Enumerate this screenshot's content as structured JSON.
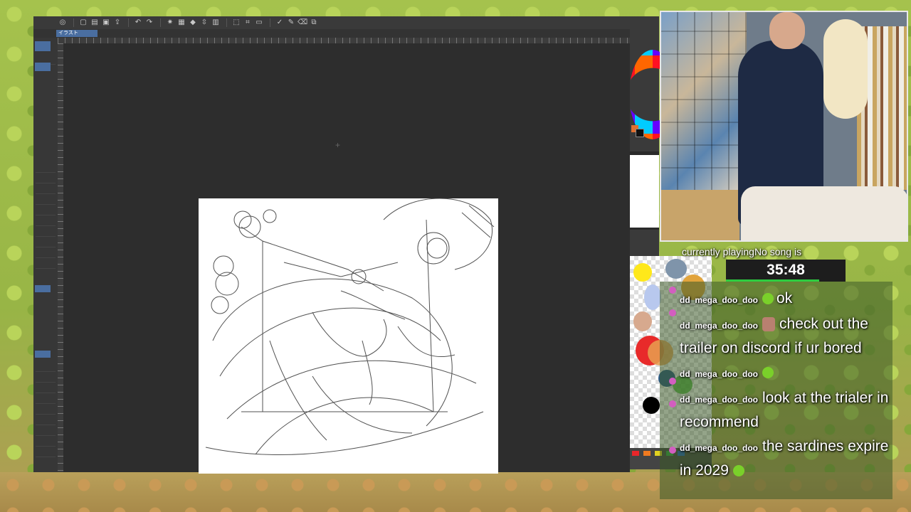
{
  "app": {
    "document_tab": "イラスト",
    "toolbar_icons": [
      "app-menu-icon",
      "new-icon",
      "open-icon",
      "save-icon",
      "undo-icon",
      "redo-icon",
      "settings-icon",
      "fill-icon",
      "transform-icon",
      "pen-icon",
      "brush-icon",
      "eraser-icon",
      "select-icon"
    ]
  },
  "overlay": {
    "now_playing": "currently playingNo song is",
    "timer": "35:48",
    "timer_progress": 0.78
  },
  "chat": [
    {
      "user": "dd_mega_doo_doo",
      "emote": "green-blob",
      "text": "ok"
    },
    {
      "user": "dd_mega_doo_doo",
      "emote": "face",
      "text": "check out the trailer on discord if ur bored"
    },
    {
      "user": "dd_mega_doo_doo",
      "emote": "green-blob",
      "text": ""
    },
    {
      "user": "dd_mega_doo_doo",
      "emote": "",
      "text": "look at the trialer in recommend"
    },
    {
      "user": "dd_mega_doo_doo",
      "emote": "",
      "text": "the sardines expire in 2029",
      "trailing_emote": "green-blob"
    }
  ],
  "colors": {
    "accent_blue": "#4a6ea0",
    "timer_bar": "#2ecc40",
    "background_green": "#9dbb45"
  }
}
